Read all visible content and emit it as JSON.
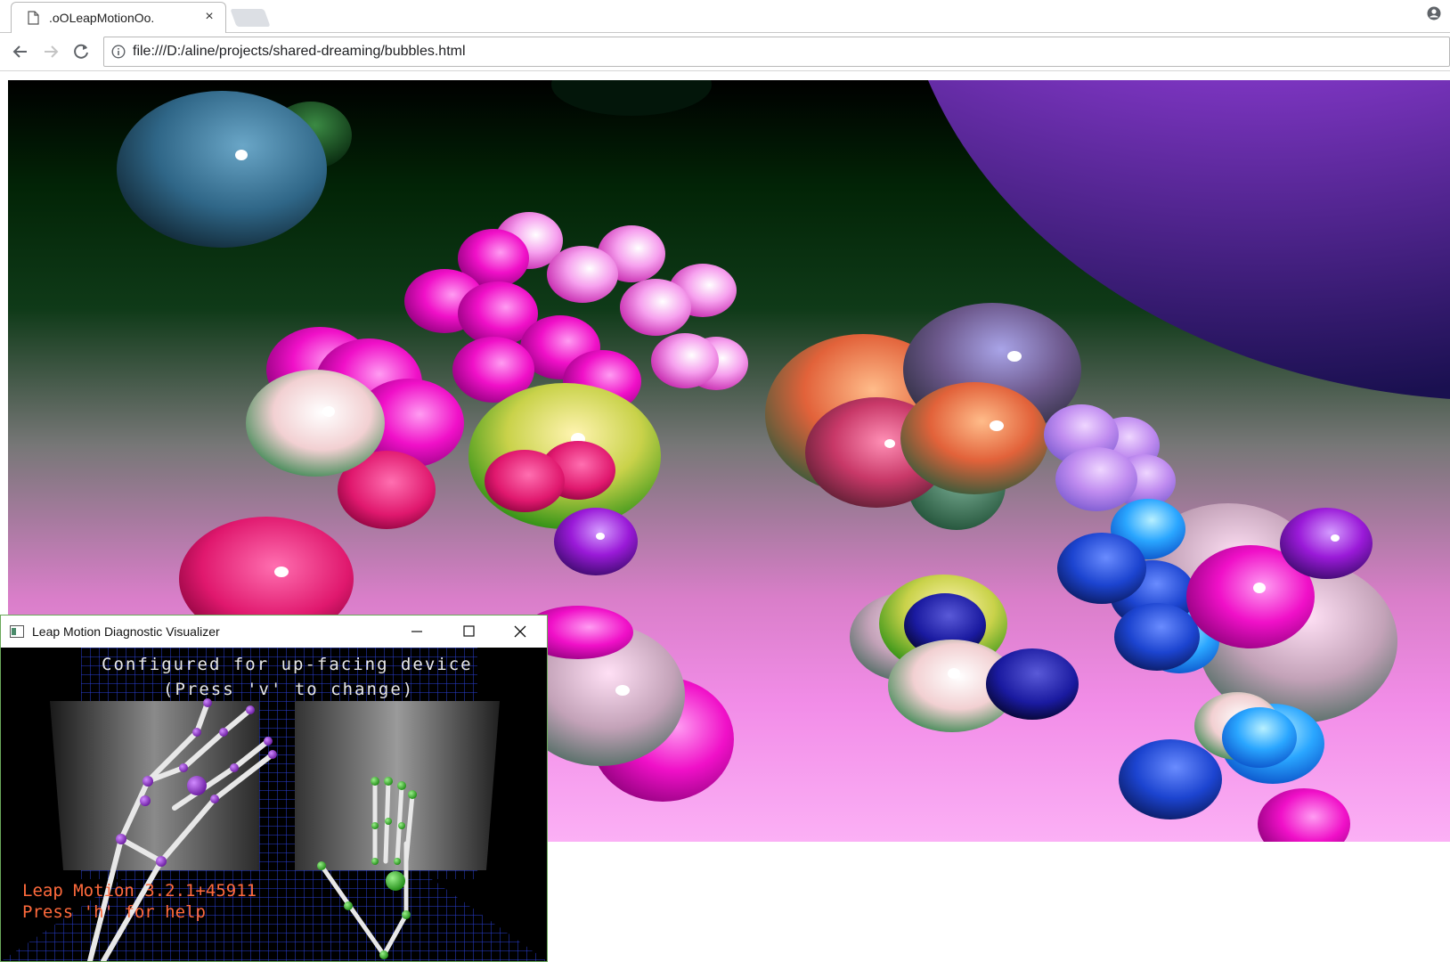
{
  "browser": {
    "tab_title": ".oOLeapMotionOo.",
    "tab_close": "×",
    "url": "file:///D:/aline/projects/shared-dreaming/bubbles.html"
  },
  "icons": {
    "back": "arrow-left-icon",
    "forward": "arrow-right-icon",
    "reload": "reload-icon",
    "info": "info-icon",
    "profile": "profile-icon",
    "page": "page-icon"
  },
  "visualizer": {
    "window_title": "Leap Motion Diagnostic Visualizer",
    "overlay_line1": "Configured for up-facing device",
    "overlay_line2": "(Press 'v' to change)",
    "version_line": "Leap Motion 3.2.1+45911",
    "help_line": "Press 'h' for help"
  },
  "colors": {
    "chrome_bg": "#ffffff",
    "grid": "#2a3fd6",
    "version_text": "#ff6a3c",
    "hand_joint_left": "#8a2bc0",
    "hand_joint_right": "#3ec72a"
  }
}
